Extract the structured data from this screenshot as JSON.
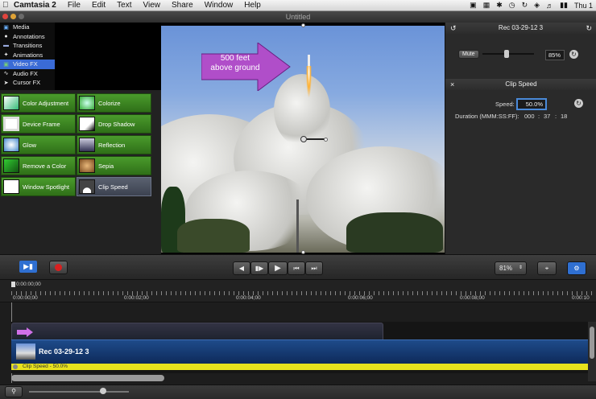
{
  "menubar": {
    "app_name": "Camtasia 2",
    "items": [
      "File",
      "Edit",
      "Text",
      "View",
      "Share",
      "Window",
      "Help"
    ],
    "clock": "Thu 1"
  },
  "window": {
    "title": "Untitled"
  },
  "sidebar": {
    "items": [
      {
        "label": "Media",
        "icon": "media-icon",
        "active": false
      },
      {
        "label": "Annotations",
        "icon": "annotations-icon",
        "active": false
      },
      {
        "label": "Transitions",
        "icon": "transitions-icon",
        "active": false
      },
      {
        "label": "Animations",
        "icon": "animations-icon",
        "active": false
      },
      {
        "label": "Video FX",
        "icon": "video-fx-icon",
        "active": true
      },
      {
        "label": "Audio FX",
        "icon": "audio-fx-icon",
        "active": false
      },
      {
        "label": "Cursor FX",
        "icon": "cursor-fx-icon",
        "active": false
      }
    ]
  },
  "effects": [
    {
      "label": "Color Adjustment",
      "selected": false
    },
    {
      "label": "Colorize",
      "selected": false
    },
    {
      "label": "Device Frame",
      "selected": false
    },
    {
      "label": "Drop Shadow",
      "selected": false
    },
    {
      "label": "Glow",
      "selected": false
    },
    {
      "label": "Reflection",
      "selected": false
    },
    {
      "label": "Remove a Color",
      "selected": false
    },
    {
      "label": "Sepia",
      "selected": false
    },
    {
      "label": "Window Spotlight",
      "selected": false
    },
    {
      "label": "Clip Speed",
      "selected": true
    }
  ],
  "canvas": {
    "callout_line1": "500 feet",
    "callout_line2": "above ground",
    "callout_color": "#b04ec9"
  },
  "properties": {
    "clip_title": "Rec 03-29-12 3",
    "mute_label": "Mute",
    "volume": "85%",
    "volume_fraction": 0.85,
    "section_title": "Clip Speed",
    "speed_label": "Speed:",
    "speed_value": "50.0%",
    "duration_label": "Duration (MMM:SS:FF):",
    "duration_min": "000",
    "duration_sec": "37",
    "duration_frames": "18"
  },
  "toolbar": {
    "zoom": "81%"
  },
  "timeline": {
    "playhead_time": "0:00:00;00",
    "ticks": [
      "0:00:00;00",
      "0:00:02;00",
      "0:00:04;00",
      "0:00:06;00",
      "0:00:08;00",
      "0:00:10"
    ],
    "clip_name": "Rec 03-29-12 3",
    "speed_bar_label": "Clip Speed - 50.0%"
  },
  "colors": {
    "accent_blue": "#3a6bd6",
    "fx_green": "#3f8a22",
    "record_red": "#d92020",
    "speed_yellow": "#e7e21d"
  }
}
